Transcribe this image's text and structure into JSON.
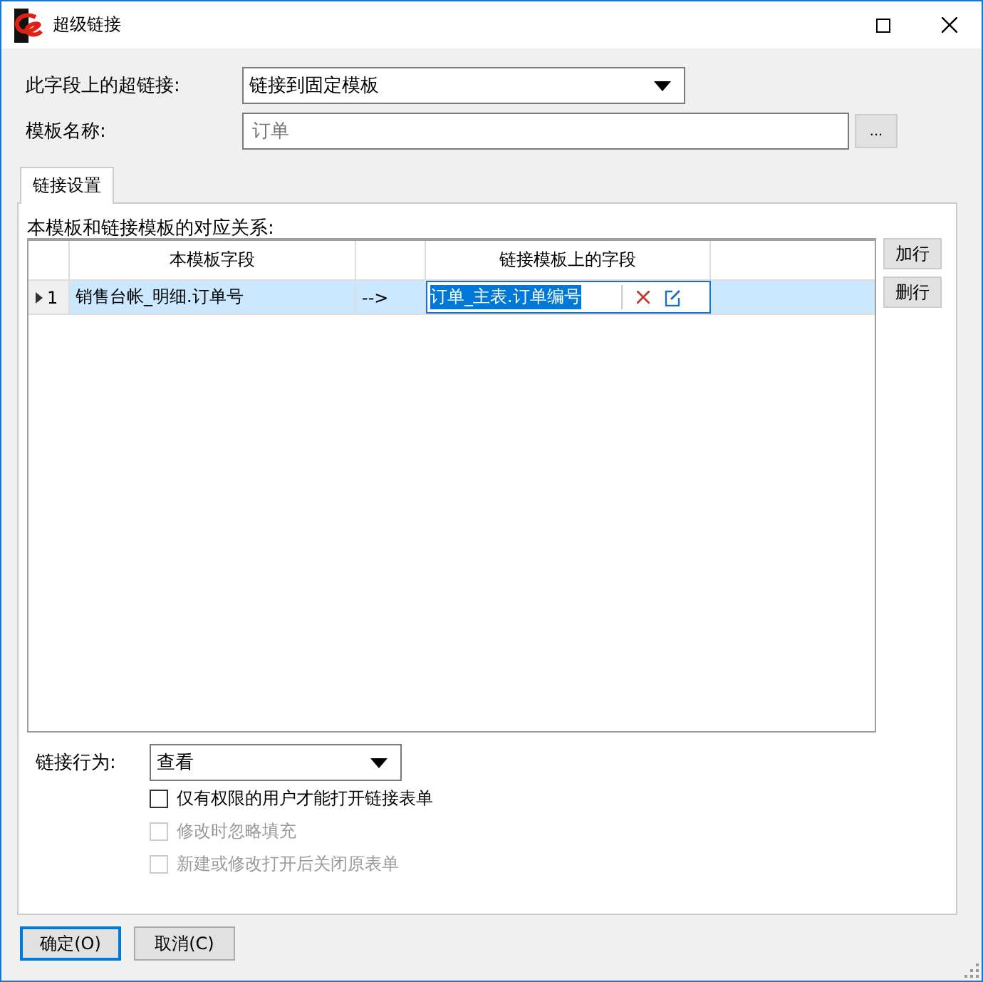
{
  "window": {
    "title": "超级链接"
  },
  "hyperlink": {
    "label": "此字段上的超链接:",
    "value": "链接到固定模板"
  },
  "template": {
    "label": "模板名称:",
    "placeholder": "订单",
    "browse": "..."
  },
  "tabs": [
    {
      "label": "链接设置",
      "selected": true
    }
  ],
  "mapping": {
    "label": "本模板和链接模板的对应关系:",
    "columns": [
      "本模板字段",
      "链接模板上的字段"
    ],
    "rows": [
      {
        "number": "1",
        "selected": true,
        "source": "销售台帐_明细.订单号",
        "arrow": "-->",
        "target": "订单_主表.订单编号"
      }
    ],
    "buttons": [
      "加行",
      "删行"
    ]
  },
  "action": {
    "label": "链接行为:",
    "value": "查看"
  },
  "options": [
    {
      "label": "仅有权限的用户才能打开链接表单",
      "checked": false,
      "disabled": false
    },
    {
      "label": "修改时忽略填充",
      "checked": false,
      "disabled": true
    },
    {
      "label": "新建或修改打开后关闭原表单",
      "checked": false,
      "disabled": true
    }
  ],
  "buttons": [
    {
      "label": "确定(O)",
      "default": true
    },
    {
      "label": "取消(C)",
      "default": false
    }
  ]
}
